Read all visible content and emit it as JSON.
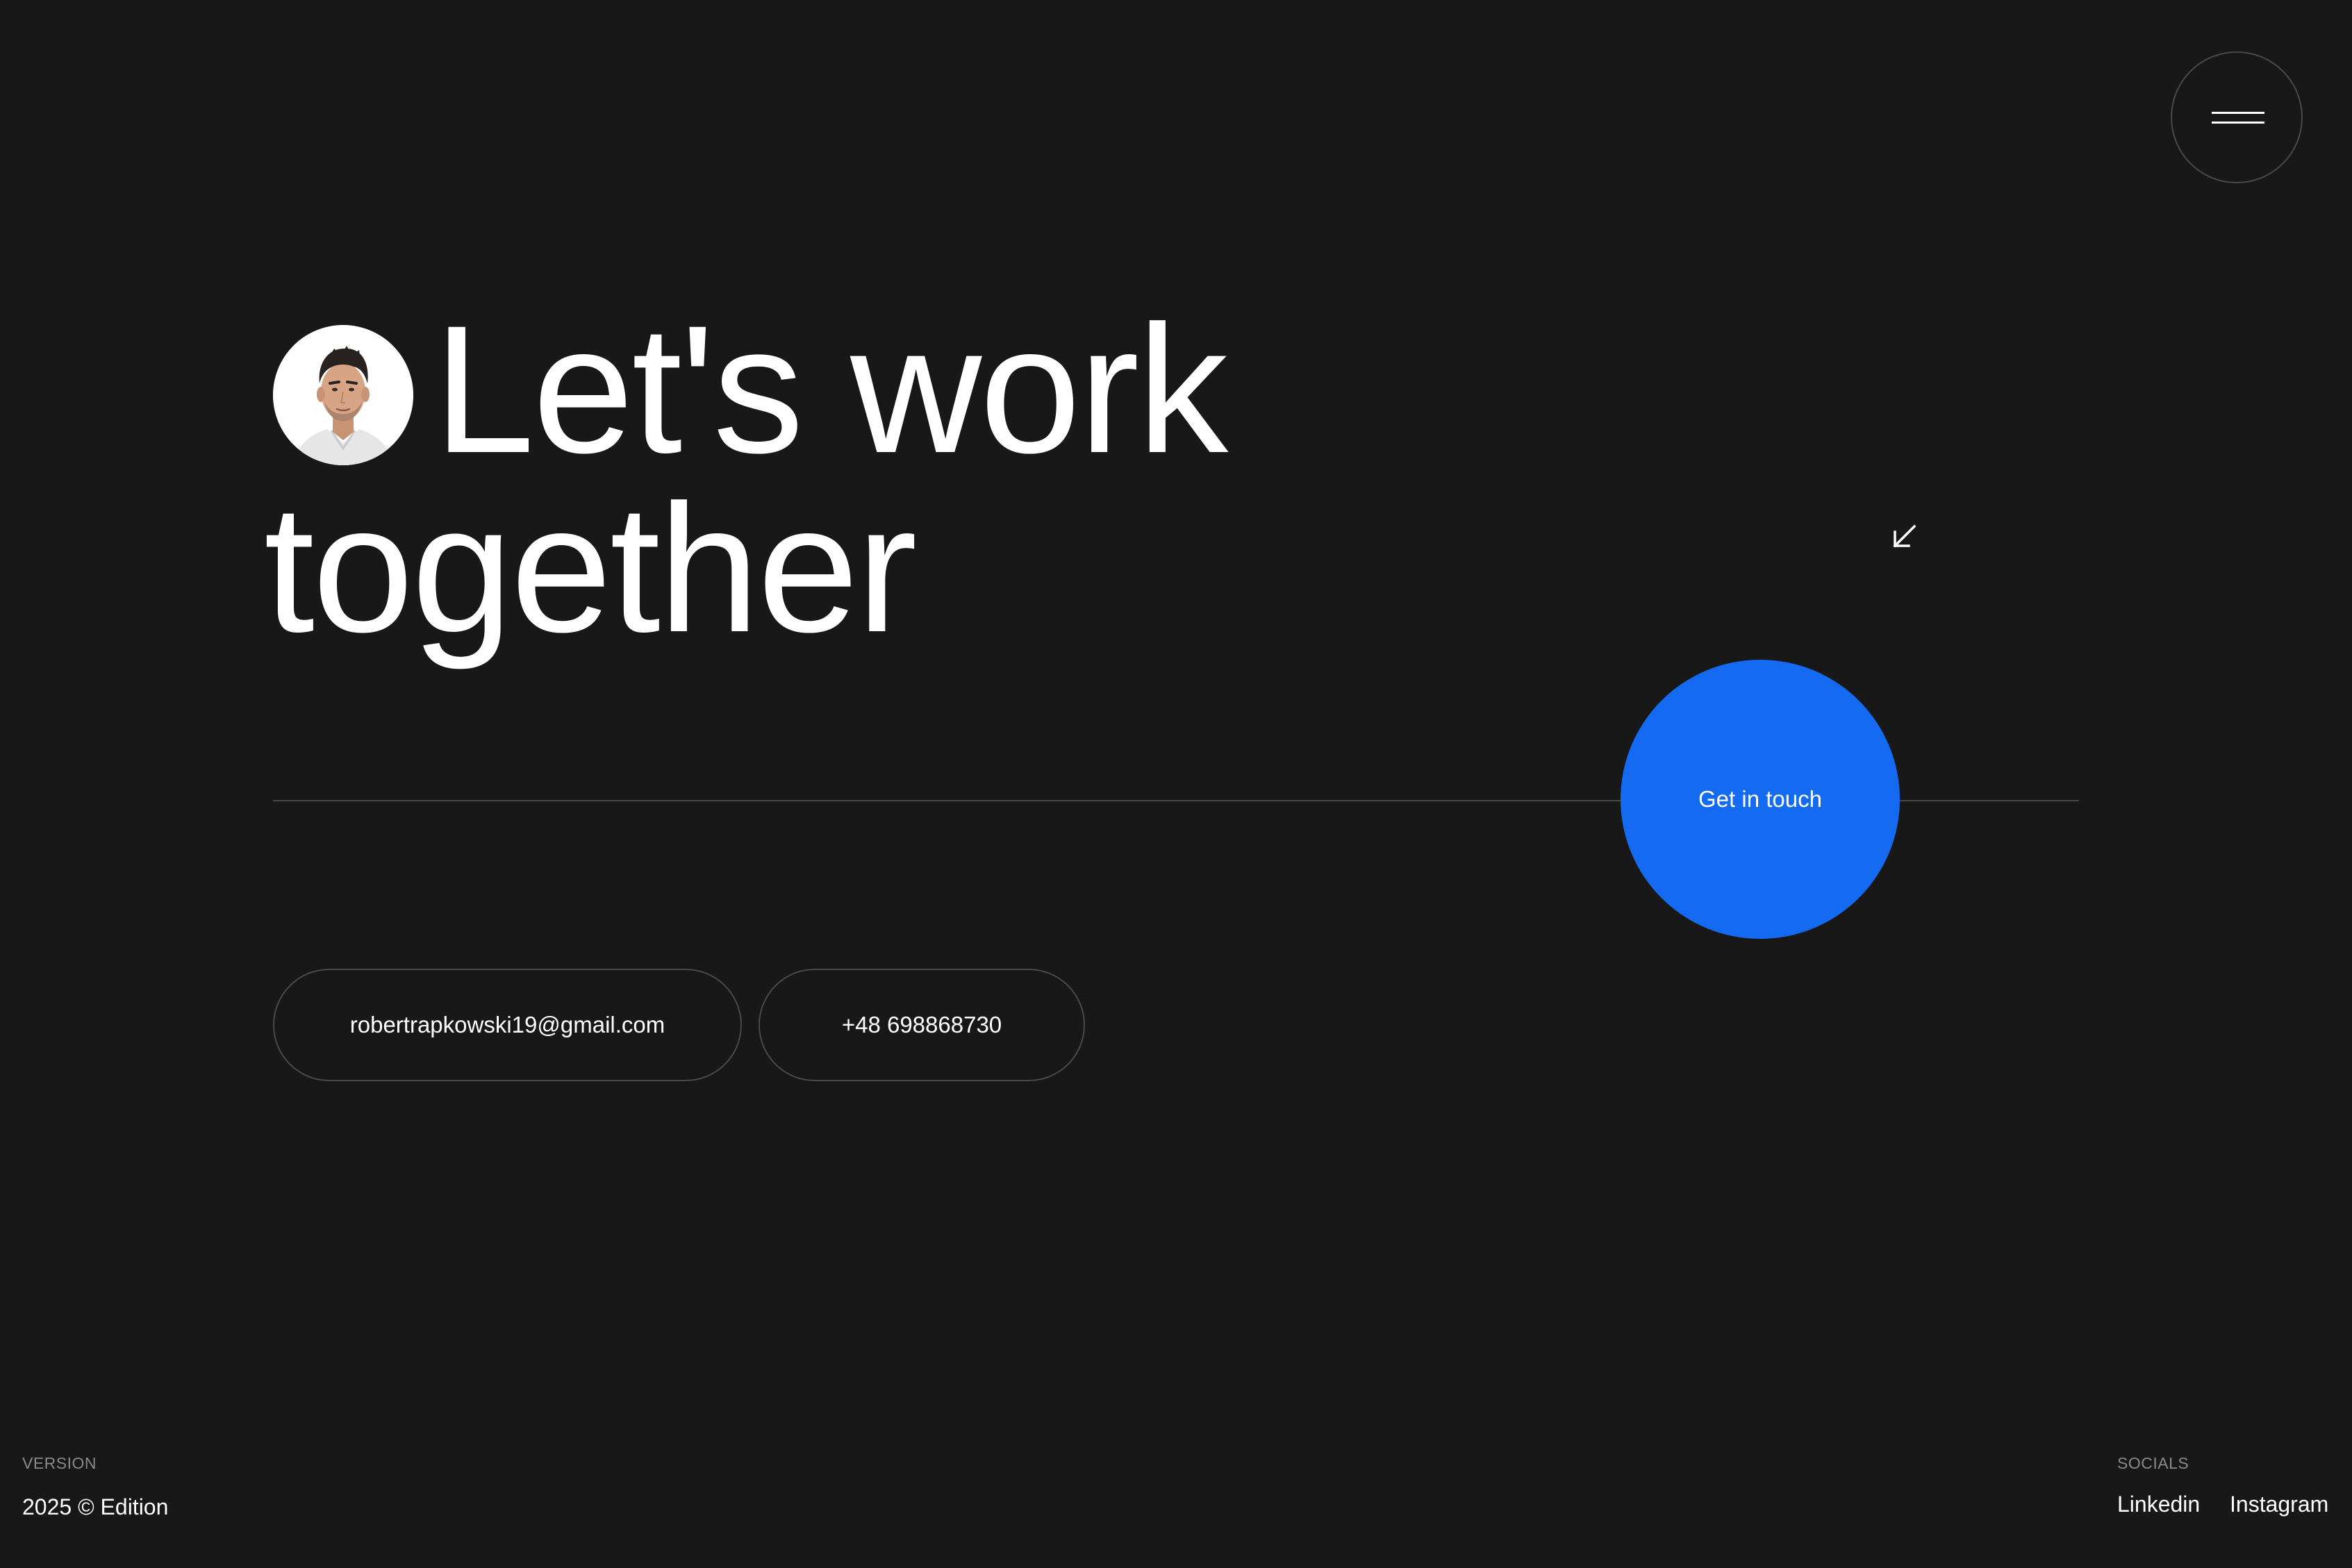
{
  "headline": {
    "line1": "Let's work",
    "line2": "together"
  },
  "cta": {
    "label": "Get in touch",
    "color": "#146af0"
  },
  "contacts": {
    "email": "robertrapkowski19@gmail.com",
    "phone": "+48 698868730"
  },
  "footer": {
    "version_label": "VERSION",
    "version_value": "2025 © Edition",
    "socials_label": "SOCIALS",
    "socials": [
      {
        "label": "Linkedin"
      },
      {
        "label": "Instagram"
      }
    ]
  },
  "icons": {
    "menu": "hamburger-menu-icon",
    "arrow": "arrow-down-left-icon",
    "avatar": "profile-photo"
  },
  "colors": {
    "background": "#181818",
    "text": "#ffffff",
    "accent": "#146af0",
    "border": "#4a4a4a",
    "muted": "#8a8a8a"
  }
}
